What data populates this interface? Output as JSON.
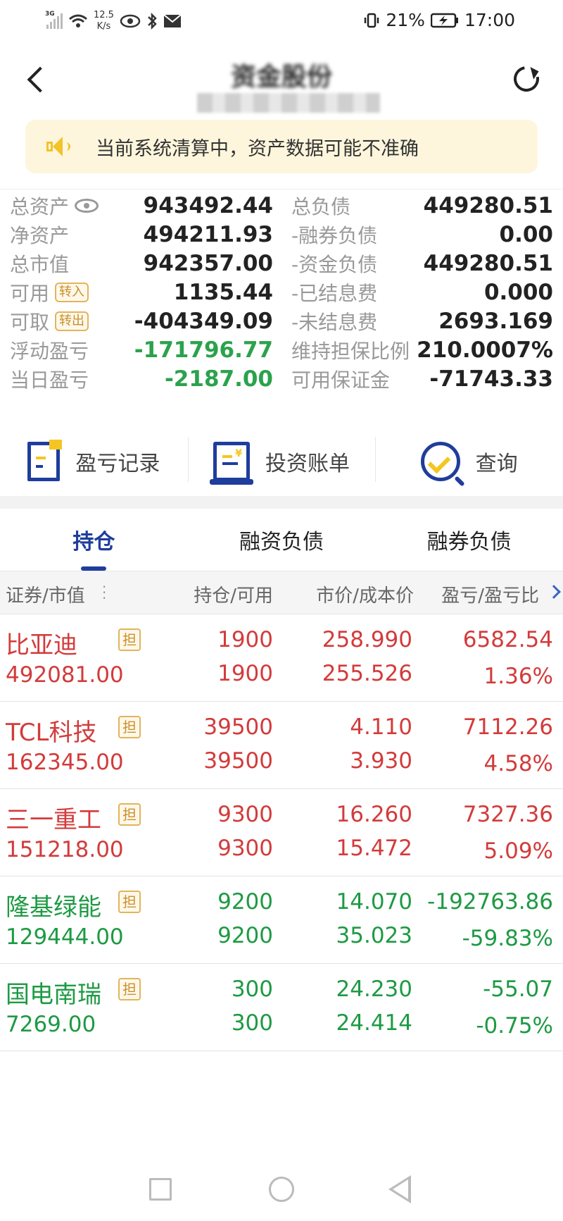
{
  "status_bar": {
    "network": "3G",
    "speed_value": "12.5",
    "speed_unit": "K/s",
    "battery": "21%",
    "time": "17:00"
  },
  "header": {
    "title": "资金股份",
    "account_masked": ""
  },
  "notice": {
    "text": "当前系统清算中，资产数据可能不准确"
  },
  "assets": {
    "left": [
      {
        "label": "总资产",
        "value": "943492.44"
      },
      {
        "label": "净资产",
        "value": "494211.93"
      },
      {
        "label": "总市值",
        "value": "942357.00"
      },
      {
        "label": "可用",
        "tag": "转入",
        "value": "1135.44"
      },
      {
        "label": "可取",
        "tag": "转出",
        "value": "-404349.09"
      },
      {
        "label": "浮动盈亏",
        "value": "-171796.77"
      },
      {
        "label": "当日盈亏",
        "value": "-2187.00"
      }
    ],
    "right": [
      {
        "label": "总负债",
        "value": "449280.51"
      },
      {
        "label": "-融券负债",
        "value": "0.00"
      },
      {
        "label": "-资金负债",
        "value": "449280.51"
      },
      {
        "label": "-已结息费",
        "value": "0.000"
      },
      {
        "label": "-未结息费",
        "value": "2693.169"
      },
      {
        "label": "维持担保比例",
        "value": "210.0007%"
      },
      {
        "label": "可用保证金",
        "value": "-71743.33"
      }
    ]
  },
  "actions": [
    {
      "label": "盈亏记录",
      "icon": "profit-record-icon"
    },
    {
      "label": "投资账单",
      "icon": "investment-bill-icon"
    },
    {
      "label": "查询",
      "icon": "query-icon"
    }
  ],
  "tabs": [
    {
      "label": "持仓",
      "active": true
    },
    {
      "label": "融资负债",
      "active": false
    },
    {
      "label": "融券负债",
      "active": false
    }
  ],
  "table": {
    "headers": [
      "证券/市值",
      "持仓/可用",
      "市价/成本价",
      "盈亏/盈亏比"
    ],
    "tag": "担",
    "rows": [
      {
        "name": "比亚迪",
        "market_value": "492081.00",
        "hold": "1900",
        "avail": "1900",
        "price": "258.990",
        "cost": "255.526",
        "pnl": "6582.54",
        "pnl_ratio": "1.36%",
        "color": "red"
      },
      {
        "name": "TCL科技",
        "market_value": "162345.00",
        "hold": "39500",
        "avail": "39500",
        "price": "4.110",
        "cost": "3.930",
        "pnl": "7112.26",
        "pnl_ratio": "4.58%",
        "color": "red"
      },
      {
        "name": "三一重工",
        "market_value": "151218.00",
        "hold": "9300",
        "avail": "9300",
        "price": "16.260",
        "cost": "15.472",
        "pnl": "7327.36",
        "pnl_ratio": "5.09%",
        "color": "red"
      },
      {
        "name": "隆基绿能",
        "market_value": "129444.00",
        "hold": "9200",
        "avail": "9200",
        "price": "14.070",
        "cost": "35.023",
        "pnl": "-192763.86",
        "pnl_ratio": "-59.83%",
        "color": "green"
      },
      {
        "name": "国电南瑞",
        "market_value": "7269.00",
        "hold": "300",
        "avail": "300",
        "price": "24.230",
        "cost": "24.414",
        "pnl": "-55.07",
        "pnl_ratio": "-0.75%",
        "color": "green"
      }
    ]
  },
  "colors": {
    "accent": "#1f3d9c",
    "gain": "#d33b3b",
    "loss": "#1e9a44",
    "notice_bg": "#fdf6dc",
    "tag": "#c8902a"
  }
}
